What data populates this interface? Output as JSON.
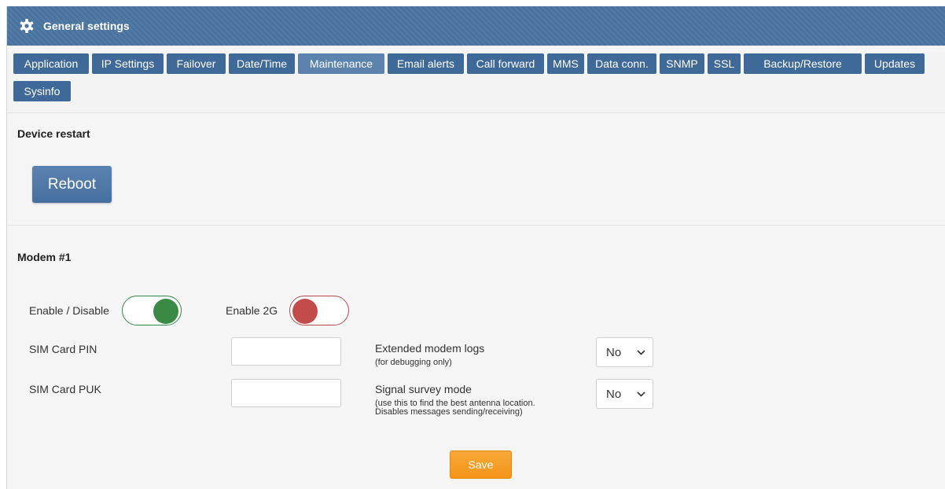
{
  "header": {
    "title": "General settings",
    "icon": "gear-icon"
  },
  "tabs": [
    {
      "label": "Application"
    },
    {
      "label": "IP Settings"
    },
    {
      "label": "Failover"
    },
    {
      "label": "Date/Time"
    },
    {
      "label": "Maintenance",
      "active": true
    },
    {
      "label": "Email alerts"
    },
    {
      "label": "Call forward"
    },
    {
      "label": "MMS"
    },
    {
      "label": "Data conn."
    },
    {
      "label": "SNMP"
    },
    {
      "label": "SSL"
    },
    {
      "label": "Backup/Restore"
    },
    {
      "label": "Updates"
    },
    {
      "label": "Sysinfo"
    }
  ],
  "device_restart": {
    "title": "Device restart",
    "reboot_label": "Reboot"
  },
  "modem": {
    "title": "Modem #1",
    "enable_label": "Enable / Disable",
    "enable_state": "on",
    "enable2g_label": "Enable 2G",
    "enable2g_state": "off",
    "sim_pin_label": "SIM Card PIN",
    "sim_pin_value": "",
    "sim_puk_label": "SIM Card PUK",
    "sim_puk_value": "",
    "ext_logs_label": "Extended modem logs",
    "ext_logs_note": "(for debugging only)",
    "ext_logs_value": "No",
    "signal_label": "Signal survey mode",
    "signal_note_1": "(use this to find the best antenna location.",
    "signal_note_2": "Disables messages sending/receiving)",
    "signal_value": "No"
  },
  "save_label": "Save",
  "colors": {
    "header": "#4a74a0",
    "tab": "#3f6998",
    "tab_active": "#5c83ae",
    "toggle_on": "#3a8a45",
    "toggle_off": "#c24b4b",
    "save": "#f39417"
  }
}
